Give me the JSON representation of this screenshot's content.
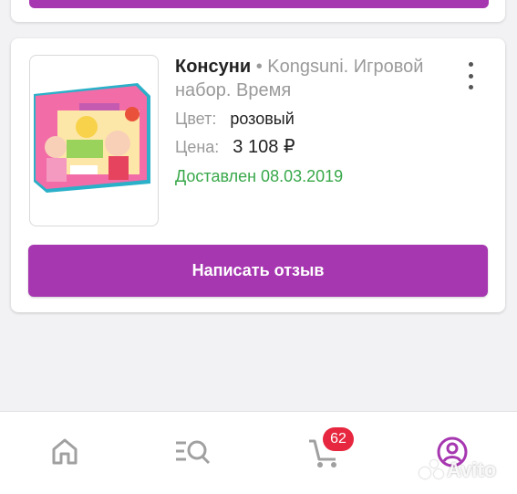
{
  "order": {
    "brand": "Консуни",
    "separator": "•",
    "title": "Kongsuni. Игровой набор. Время",
    "color_label": "Цвет:",
    "color_value": "розовый",
    "price_label": "Цена:",
    "price_value": "3 108 ₽",
    "status": "Доставлен 08.03.2019",
    "review_button": "Написать отзыв"
  },
  "nav": {
    "items": [
      {
        "name": "home",
        "icon": "home-icon"
      },
      {
        "name": "catalog",
        "icon": "catalog-search-icon"
      },
      {
        "name": "cart",
        "icon": "cart-icon",
        "badge": "62"
      },
      {
        "name": "profile",
        "icon": "profile-icon",
        "active": true
      }
    ]
  },
  "watermark": "Avito",
  "colors": {
    "accent": "#a637b0",
    "status": "#38a84a",
    "badge": "#e6273f"
  }
}
